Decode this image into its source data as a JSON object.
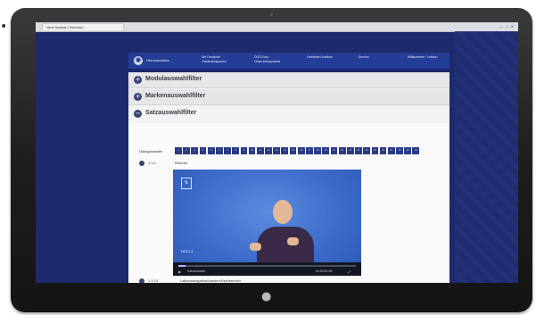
{
  "browser": {
    "tab_title": "Neue Nachbar | Hörmodul...",
    "window_buttons": "— □ ✕"
  },
  "site": {
    "brand": "Hörmodulation",
    "logo_glyph": "◉",
    "nav": [
      {
        "label": "Die Deutsche Gebärdensprache"
      },
      {
        "label": "DGS Kurs · Unterrichtssprache"
      },
      {
        "label": "Gebärden-Lexikon"
      },
      {
        "label": "Service"
      },
      {
        "label": "Willkommen · Lektion"
      }
    ]
  },
  "sections": [
    {
      "title": "Modulauswahlfilter",
      "icon": "+"
    },
    {
      "title": "Markenauswahlfilter",
      "icon": "+"
    },
    {
      "title": "Satzauswahlfilter",
      "icon": "−"
    }
  ],
  "filter": {
    "label": "Dialogauswahl",
    "items": [
      "1",
      "2",
      "3",
      "4",
      "5",
      "6",
      "7",
      "8",
      "9",
      "10",
      "11",
      "12",
      "13",
      "14",
      "15",
      "16",
      "17",
      "18",
      "19",
      "20",
      "21",
      "22",
      "23",
      "24",
      "25",
      "26",
      "27",
      "28",
      "29",
      "30"
    ]
  },
  "entries": [
    {
      "num": "1.1.1",
      "text": "Rentnet"
    },
    {
      "num": "1.1.15",
      "text": "Lalkaunavigation/Aachen/Fachbereich"
    }
  ],
  "video": {
    "badge_glyph": "⇅",
    "caption": "DGS 1.1",
    "title": "Satzauswahl",
    "play_icon": "▶",
    "time": "00:00/00:08",
    "fullscreen_icon": "⤢",
    "progress": 0.04
  },
  "hardware": {
    "apple_glyph": "●",
    "dots_left": "• • •",
    "dots_right": "•"
  }
}
